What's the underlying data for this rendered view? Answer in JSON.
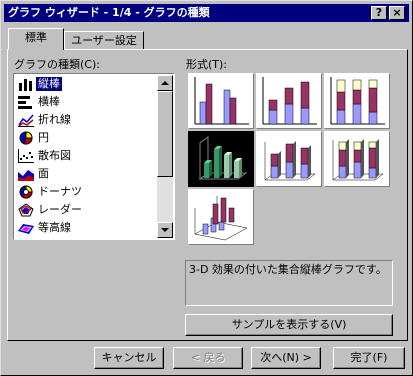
{
  "window": {
    "title": "グラフ ウィザード - 1/4 - グラフの種類",
    "help_button": "?",
    "close_button": "×"
  },
  "tabs": [
    {
      "label": "標準",
      "active": true
    },
    {
      "label": "ユーザー設定",
      "active": false
    }
  ],
  "chart_types": {
    "label": "グラフの種類(C):",
    "items": [
      {
        "label": "縦棒",
        "icon": "column-chart-icon",
        "selected": true
      },
      {
        "label": "横棒",
        "icon": "bar-chart-icon",
        "selected": false
      },
      {
        "label": "折れ線",
        "icon": "line-chart-icon",
        "selected": false
      },
      {
        "label": "円",
        "icon": "pie-chart-icon",
        "selected": false
      },
      {
        "label": "散布図",
        "icon": "scatter-chart-icon",
        "selected": false
      },
      {
        "label": "面",
        "icon": "area-chart-icon",
        "selected": false
      },
      {
        "label": "ドーナツ",
        "icon": "doughnut-chart-icon",
        "selected": false
      },
      {
        "label": "レーダー",
        "icon": "radar-chart-icon",
        "selected": false
      },
      {
        "label": "等高線",
        "icon": "surface-chart-icon",
        "selected": false
      }
    ]
  },
  "subtypes": {
    "label": "形式(T):",
    "items": [
      {
        "name": "clustered-column",
        "selected": false
      },
      {
        "name": "stacked-column",
        "selected": false
      },
      {
        "name": "100-stacked-column",
        "selected": false
      },
      {
        "name": "3d-clustered-column",
        "selected": true
      },
      {
        "name": "3d-stacked-column",
        "selected": false
      },
      {
        "name": "3d-100-stacked-column",
        "selected": false
      },
      {
        "name": "3d-column",
        "selected": false
      }
    ]
  },
  "description": "3-D 効果の付いた集合縦棒グラフです。",
  "sample_button": "サンプルを表示する(V)",
  "footer": {
    "cancel": "キャンセル",
    "back": "< 戻る",
    "next": "次へ(N) >",
    "finish": "完了(F)"
  },
  "colors": {
    "titlebar": "#000080",
    "face": "#c0c0c0",
    "series1": "#9999ff",
    "series2": "#993366",
    "series3": "#ffffcc",
    "selected3d": "#339966"
  }
}
